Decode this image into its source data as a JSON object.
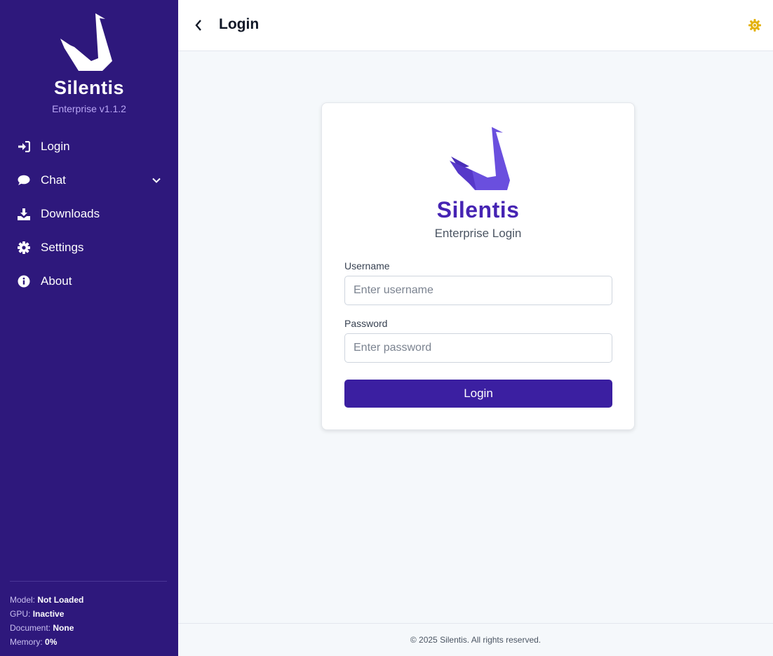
{
  "brand": {
    "name": "Silentis",
    "version": "Enterprise v1.1.2"
  },
  "nav": {
    "items": [
      {
        "label": "Login",
        "icon": "sign-in-icon"
      },
      {
        "label": "Chat",
        "icon": "chat-bubble-icon"
      },
      {
        "label": "Downloads",
        "icon": "download-icon"
      },
      {
        "label": "Settings",
        "icon": "gear-icon"
      },
      {
        "label": "About",
        "icon": "info-icon"
      }
    ]
  },
  "status": {
    "model_label": "Model:",
    "model_value": "Not Loaded",
    "gpu_label": "GPU:",
    "gpu_value": "Inactive",
    "document_label": "Document:",
    "document_value": "None",
    "memory_label": "Memory:",
    "memory_value": "0%"
  },
  "header": {
    "title": "Login"
  },
  "login_card": {
    "brand": "Silentis",
    "subtitle": "Enterprise Login",
    "username_label": "Username",
    "username_placeholder": "Enter username",
    "password_label": "Password",
    "password_placeholder": "Enter password",
    "submit_label": "Login"
  },
  "footer": {
    "text": "© 2025 Silentis. All rights reserved."
  },
  "colors": {
    "sidebar": "#2e187c",
    "accent": "#3b1fa1",
    "brand_text": "#4624b3",
    "theme_icon": "#e3b10c"
  }
}
